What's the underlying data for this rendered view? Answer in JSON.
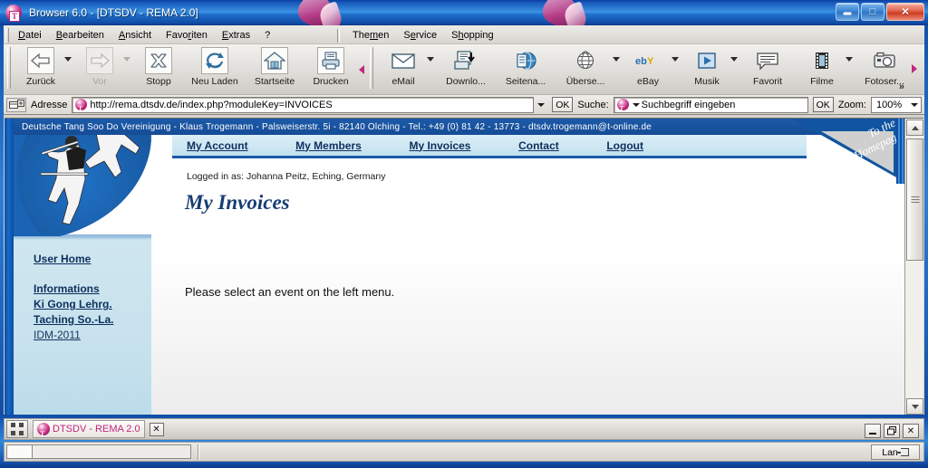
{
  "window": {
    "title": "Browser 6.0 - [DTSDV - REMA 2.0]",
    "icon": "t-online-icon",
    "buttons": {
      "minimize": "_",
      "maximize": "□",
      "close": "✕"
    }
  },
  "menubar": {
    "items": [
      "Datei",
      "Bearbeiten",
      "Ansicht",
      "Favoriten",
      "Extras",
      "?"
    ],
    "right_items": [
      "Themen",
      "Service",
      "Shopping"
    ]
  },
  "toolbar": {
    "buttons": [
      {
        "label": "Zurück",
        "icon": "back-arrow-icon",
        "disabled": false,
        "dropdown": true
      },
      {
        "label": "Vor",
        "icon": "forward-arrow-icon",
        "disabled": true,
        "dropdown": true
      },
      {
        "label": "Stopp",
        "icon": "stop-x-icon",
        "disabled": false,
        "dropdown": false
      },
      {
        "label": "Neu Laden",
        "icon": "reload-icon",
        "disabled": false,
        "dropdown": false
      },
      {
        "label": "Startseite",
        "icon": "home-icon",
        "disabled": false,
        "dropdown": false
      },
      {
        "label": "Drucken",
        "icon": "printer-icon",
        "disabled": false,
        "dropdown": false
      }
    ],
    "buttons2": [
      {
        "label": "eMail",
        "icon": "envelope-icon",
        "dropdown": true
      },
      {
        "label": "Downlo...",
        "icon": "download-icon",
        "dropdown": false
      },
      {
        "label": "Seitena...",
        "icon": "globe-page-icon",
        "dropdown": false
      },
      {
        "label": "Überse...",
        "icon": "translate-globe-icon",
        "dropdown": true
      },
      {
        "label": "eBay",
        "icon": "ebay-icon",
        "dropdown": true
      },
      {
        "label": "Musik",
        "icon": "play-icon",
        "dropdown": true
      },
      {
        "label": "Favorit",
        "icon": "speech-bubble-icon",
        "dropdown": false
      },
      {
        "label": "Filme",
        "icon": "film-strip-icon",
        "dropdown": true
      },
      {
        "label": "Fotoser...",
        "icon": "camera-icon",
        "dropdown": false
      }
    ],
    "overflow": "»"
  },
  "addressbar": {
    "label": "Adresse",
    "url": "http://rema.dtsdv.de/index.php?moduleKey=INVOICES",
    "go_label": "OK",
    "search_label": "Suche:",
    "search_placeholder": "Suchbegriff eingeben",
    "search_go_label": "OK",
    "zoom_label": "Zoom:",
    "zoom_value": "100%"
  },
  "page": {
    "banner": "Deutsche Tang Soo Do Vereinigung - Klaus Trogemann - Palsweiserstr. 5i - 82140 Olching - Tel.: +49 (0) 81 42 - 13773 - dtsdv.trogemann@t-online.de",
    "corner_ribbon": {
      "line1": "To the",
      "line2": "Homepage"
    },
    "logo_alt": "tang-soo-do-logo",
    "nav": [
      {
        "label": "My Account"
      },
      {
        "label": "My Members"
      },
      {
        "label": "My Invoices"
      },
      {
        "label": "Contact"
      },
      {
        "label": "Logout"
      }
    ],
    "logged_in": "Logged in as: Johanna Peitz, Eching, Germany",
    "title": "My Invoices",
    "message": "Please select an event on the left menu.",
    "sidebar": {
      "home": "User Home",
      "items": [
        {
          "label": "Informations",
          "style": "bold"
        },
        {
          "label": "Ki Gong Lehrg.",
          "style": "bold"
        },
        {
          "label": "Taching So.-La.",
          "style": "bold"
        },
        {
          "label": "IDM-2011",
          "style": "light"
        }
      ]
    }
  },
  "taskbar": {
    "start_icon": "show-desktop-icon",
    "task_label": "DTSDV - REMA 2.0",
    "task_close": "✕",
    "window_buttons": {
      "minimize": "_",
      "restore": "❐",
      "close": "✕"
    }
  },
  "statusbar": {
    "text": "",
    "connection": "Lan"
  },
  "colors": {
    "accent_blue": "#1b5aa6",
    "banner_blue": "#154c96",
    "sidebar_blue": "#c7e2ee",
    "link_navy": "#0d2f5e",
    "brand_pink": "#c2267c"
  }
}
